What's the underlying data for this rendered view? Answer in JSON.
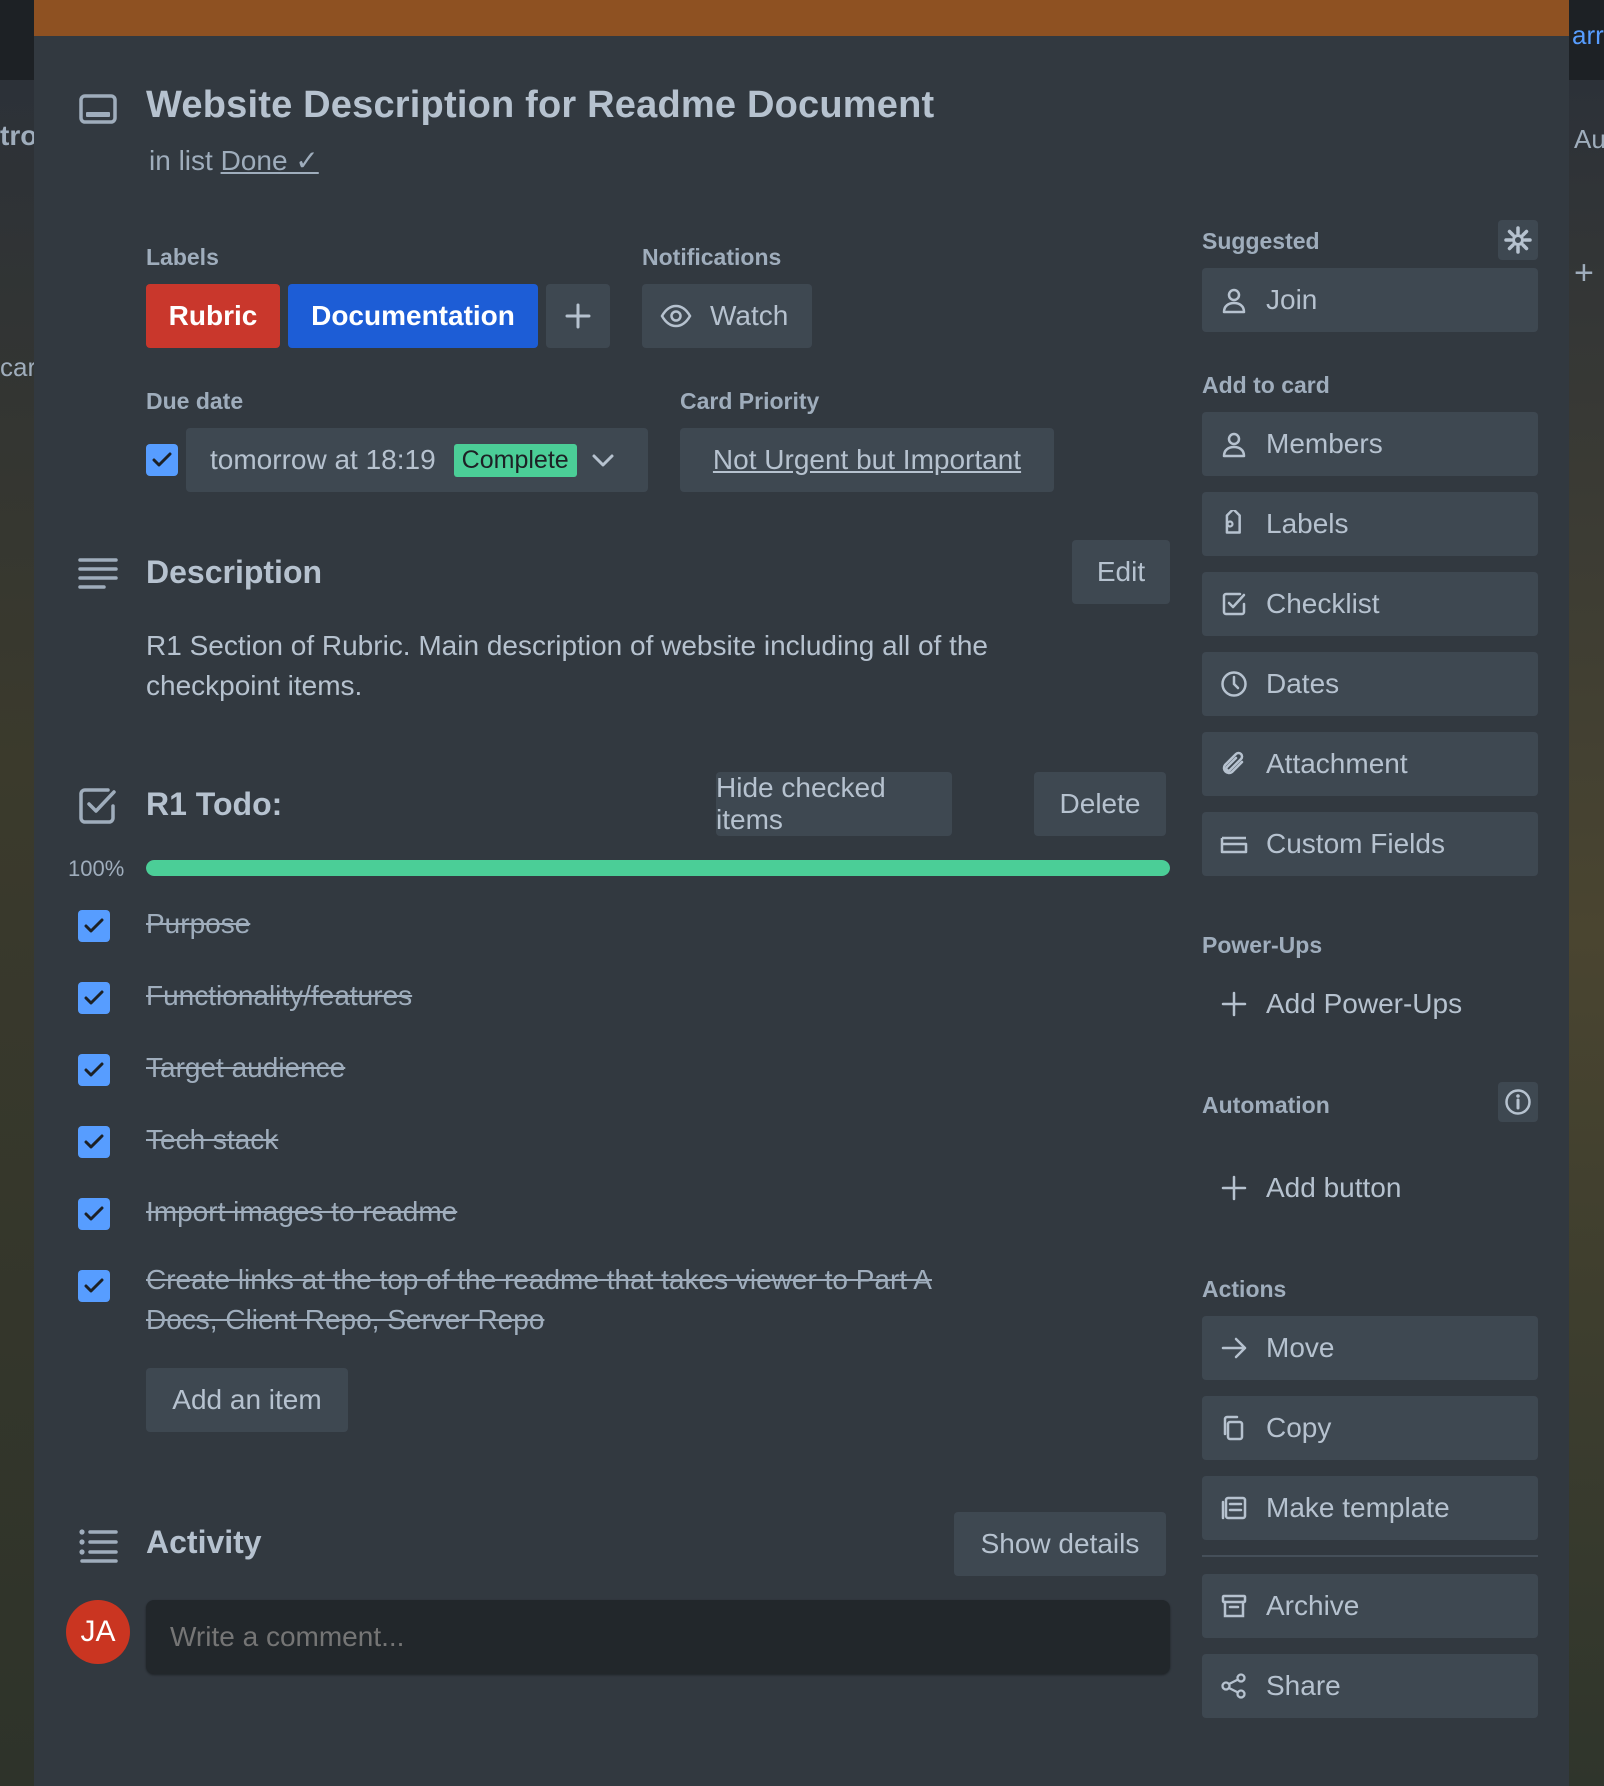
{
  "card": {
    "title": "Website Description for Readme Document",
    "in_list_prefix": "in list",
    "list_name": "Done ✓"
  },
  "labels": {
    "heading": "Labels",
    "items": [
      {
        "name": "Rubric",
        "color": "#f87168"
      },
      {
        "name": "Documentation",
        "color": "#579dff"
      }
    ]
  },
  "notifications": {
    "heading": "Notifications",
    "watch_label": "Watch"
  },
  "due_date": {
    "heading": "Due date",
    "value": "tomorrow at 18:19",
    "status": "Complete",
    "checked": true
  },
  "priority": {
    "heading": "Card Priority",
    "value": "Not Urgent but Important"
  },
  "description": {
    "heading": "Description",
    "edit_label": "Edit",
    "text": "R1 Section of Rubric. Main description of website including all of the checkpoint items."
  },
  "checklist": {
    "title": "R1 Todo:",
    "hide_label": "Hide checked items",
    "delete_label": "Delete",
    "progress_text": "100%",
    "progress": 1.0,
    "items": [
      {
        "text": "Purpose",
        "checked": true
      },
      {
        "text": "Functionality/features",
        "checked": true
      },
      {
        "text": "Target audience",
        "checked": true
      },
      {
        "text": "Tech stack",
        "checked": true
      },
      {
        "text": "Import images to readme",
        "checked": true
      },
      {
        "text": "Create links at the top of the readme that takes viewer to Part A Docs, Client Repo, Server Repo",
        "checked": true
      }
    ],
    "add_item_label": "Add an item"
  },
  "activity": {
    "heading": "Activity",
    "show_details_label": "Show details",
    "avatar_initials": "JA",
    "comment_placeholder": "Write a comment..."
  },
  "sidebar": {
    "suggested": {
      "heading": "Suggested",
      "join_label": "Join"
    },
    "add_to_card": {
      "heading": "Add to card",
      "items": [
        "Members",
        "Labels",
        "Checklist",
        "Dates",
        "Attachment",
        "Custom Fields"
      ]
    },
    "power_ups": {
      "heading": "Power-Ups",
      "add_label": "Add Power-Ups"
    },
    "automation": {
      "heading": "Automation",
      "add_label": "Add button"
    },
    "actions": {
      "heading": "Actions",
      "items": [
        "Move",
        "Copy",
        "Make template",
        "Archive",
        "Share"
      ]
    }
  },
  "background_text": {
    "left_top": "tro",
    "left_mid": "car",
    "right_top": "arr",
    "right_mid": "Au"
  },
  "colors": {
    "cover": "#8e5122",
    "modal_bg": "#323940",
    "progress": "#4bce97",
    "checkbox": "#579dff",
    "avatar": "#ca3521"
  }
}
